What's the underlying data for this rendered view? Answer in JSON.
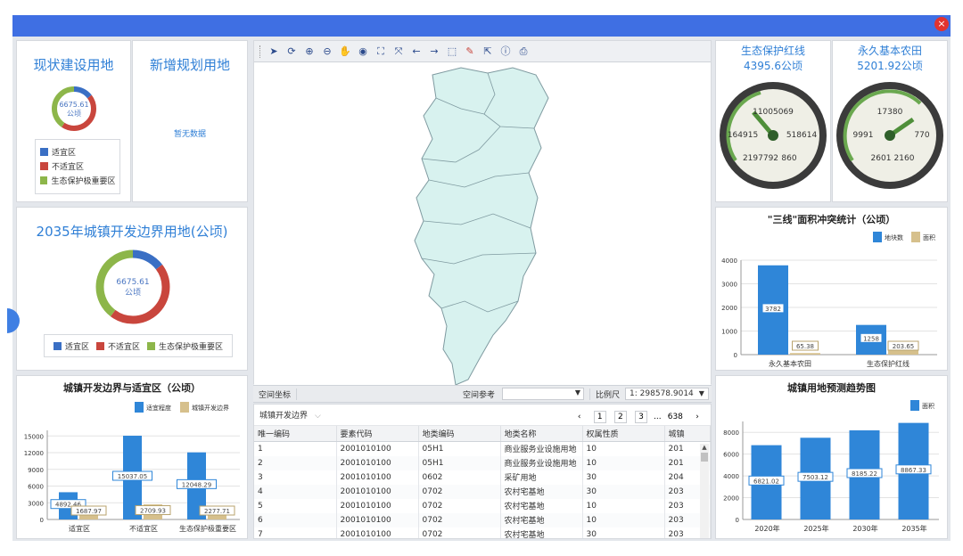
{
  "window": {
    "close_glyph": "×"
  },
  "panel_existing": {
    "title": "现状建设用地",
    "donut_value": "6675.61",
    "donut_unit": "公顷",
    "legend": [
      {
        "label": "适宜区",
        "color": "#3a6fc4"
      },
      {
        "label": "不适宜区",
        "color": "#c9463d"
      },
      {
        "label": "生态保护极重要区",
        "color": "#8db64a"
      }
    ]
  },
  "panel_new": {
    "title": "新增规划用地",
    "empty_text": "暂无数据"
  },
  "panel_2035": {
    "title": "2035年城镇开发边界用地(公顷)",
    "donut_value": "6675.61",
    "donut_unit": "公顷",
    "legend": [
      {
        "label": "适宜区",
        "color": "#3a6fc4"
      },
      {
        "label": "不适宜区",
        "color": "#c9463d"
      },
      {
        "label": "生态保护极重要区",
        "color": "#8db64a"
      }
    ]
  },
  "chart_suitability": {
    "chart_data": {
      "type": "bar",
      "title": "城镇开发边界与适宜区（公顷）",
      "categories": [
        "适宜区",
        "不适宜区",
        "生态保护极重要区"
      ],
      "series": [
        {
          "name": "适宜程度",
          "values": [
            4892.46,
            15037.05,
            12048.29
          ],
          "color": "#2f86d8"
        },
        {
          "name": "城镇开发边界",
          "values": [
            1687.97,
            2709.93,
            2277.71
          ],
          "color": "#d6c08c"
        }
      ],
      "ylim": [
        0,
        16000
      ],
      "yticks": [
        "0",
        "3000",
        "6000",
        "9000",
        "12000",
        "15000"
      ],
      "value_labels": [
        [
          "4892.46",
          "1687.97"
        ],
        [
          "15037.05",
          "2709.93"
        ],
        [
          "12048.29",
          "2277.71"
        ]
      ]
    }
  },
  "map": {
    "toolbar_icons": [
      "pointer-icon",
      "refresh-icon",
      "zoom-in-icon",
      "zoom-out-icon",
      "pan-hand-icon",
      "globe-icon",
      "full-extent-icon",
      "fit-icon",
      "back-arrow-icon",
      "forward-arrow-icon",
      "select-icon",
      "eraser-icon",
      "identify-icon",
      "info-icon",
      "print-icon"
    ],
    "toolbar_glyphs": [
      "➤",
      "⟳",
      "⊕",
      "⊖",
      "✋",
      "◉",
      "⛶",
      "⤧",
      "←",
      "→",
      "⬚",
      "✎",
      "⇱",
      "ⓘ",
      "⎙"
    ],
    "status_coord_label": "空间坐标",
    "status_ref_label": "空间参考",
    "status_scale_label": "比例尺",
    "status_scale_value": "1: 298578.9014"
  },
  "table": {
    "layer_select": "城镇开发边界",
    "pagination": [
      "‹",
      "1",
      "2",
      "3",
      "...",
      "638",
      "›"
    ],
    "headers": [
      "唯一编码",
      "要素代码",
      "地类编码",
      "地类名称",
      "权属性质",
      "城镇"
    ],
    "rows": [
      [
        "1",
        "2001010100",
        "05H1",
        "商业服务业设施用地",
        "10",
        "201"
      ],
      [
        "2",
        "2001010100",
        "05H1",
        "商业服务业设施用地",
        "10",
        "201"
      ],
      [
        "3",
        "2001010100",
        "0602",
        "采矿用地",
        "30",
        "204"
      ],
      [
        "4",
        "2001010100",
        "0702",
        "农村宅基地",
        "30",
        "203"
      ],
      [
        "5",
        "2001010100",
        "0702",
        "农村宅基地",
        "10",
        "203"
      ],
      [
        "6",
        "2001010100",
        "0702",
        "农村宅基地",
        "10",
        "203"
      ],
      [
        "7",
        "2001010100",
        "0702",
        "农村宅基地",
        "30",
        "203"
      ]
    ]
  },
  "gauge_eco": {
    "title_line1": "生态保护红线",
    "title_line2": "4395.6公顷",
    "label_top": "11005069",
    "label_mid": "164915",
    "label_mid2": "518614",
    "label_bot": "2197792",
    "label_bot2": "860"
  },
  "gauge_farm": {
    "title_line1": "永久基本农田",
    "title_line2": "5201.92公顷",
    "label_top": "17380",
    "label_mid": "9991",
    "label_mid2": "770",
    "label_bot": "2601",
    "label_bot2": "2160"
  },
  "chart_conflict": {
    "chart_data": {
      "type": "bar",
      "title": "\"三线\"面积冲突统计（公顷）",
      "categories": [
        "永久基本农田",
        "生态保护红线"
      ],
      "series": [
        {
          "name": "地块数",
          "values": [
            3782,
            1258
          ],
          "color": "#2f86d8"
        },
        {
          "name": "面积",
          "values": [
            65.38,
            203.65
          ],
          "color": "#d6c08c"
        }
      ],
      "ylim": [
        0,
        4000
      ],
      "yticks": [
        "0",
        "1000",
        "2000",
        "3000",
        "4000"
      ],
      "value_labels": [
        [
          "3782",
          "65.38"
        ],
        [
          "1258",
          "203.65"
        ]
      ]
    }
  },
  "chart_trend": {
    "chart_data": {
      "type": "bar",
      "title": "城镇用地预测趋势图",
      "categories": [
        "2020年",
        "2025年",
        "2030年",
        "2035年"
      ],
      "series": [
        {
          "name": "面积",
          "values": [
            6821.02,
            7503.12,
            8185.22,
            8867.33
          ],
          "color": "#2f86d8"
        }
      ],
      "ylim": [
        0,
        9000
      ],
      "yticks": [
        "0",
        "2000",
        "4000",
        "6000",
        "8000"
      ],
      "value_labels": [
        "6821.02",
        "7503.12",
        "8185.22",
        "8867.33"
      ]
    }
  }
}
